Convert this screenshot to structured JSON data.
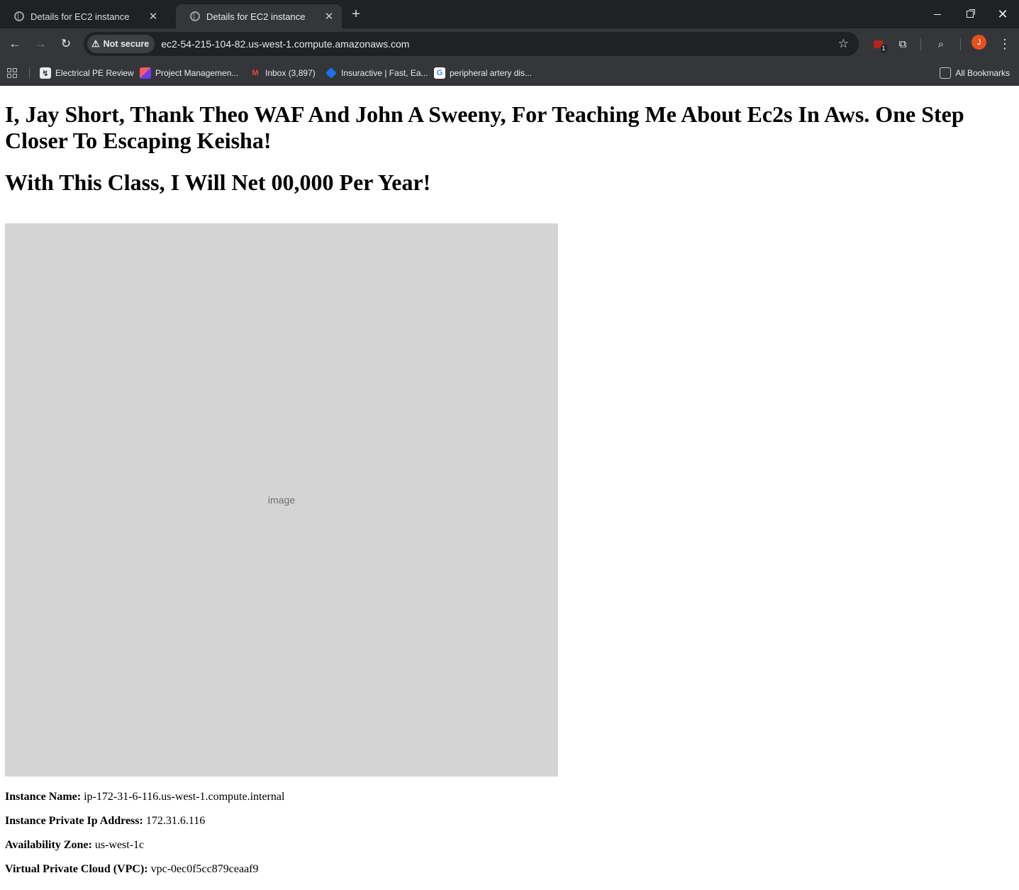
{
  "browser": {
    "tabs": [
      {
        "title": "Details for EC2 instance",
        "active": false
      },
      {
        "title": "Details for EC2 instance",
        "active": true
      }
    ],
    "security_label": "Not secure",
    "url": "ec2-54-215-104-82.us-west-1.compute.amazonaws.com",
    "extension_badge": "1",
    "profile_initial": "J",
    "bookmarks": [
      "Electrical PE Review",
      "Project Managemen...",
      "Inbox (3,897)",
      "Insuractive | Fast, Ea...",
      "peripheral artery dis..."
    ],
    "all_bookmarks": "All Bookmarks"
  },
  "page": {
    "heading1": "I, Jay Short, Thank Theo WAF And John A Sweeny, For Teaching Me About Ec2s In Aws. One Step Closer To Escaping Keisha!",
    "heading2": "With This Class, I Will Net 00,000 Per Year!",
    "details": [
      {
        "label": "Instance Name:",
        "value": "ip-172-31-6-116.us-west-1.compute.internal"
      },
      {
        "label": "Instance Private Ip Address:",
        "value": "172.31.6.116"
      },
      {
        "label": "Availability Zone:",
        "value": "us-west-1c"
      },
      {
        "label": "Virtual Private Cloud (VPC):",
        "value": "vpc-0ec0f5cc879ceaaf9"
      }
    ]
  },
  "colors": {
    "tabstrip": "#202124",
    "toolbar": "#35363a",
    "avatar": "#e8501e"
  }
}
